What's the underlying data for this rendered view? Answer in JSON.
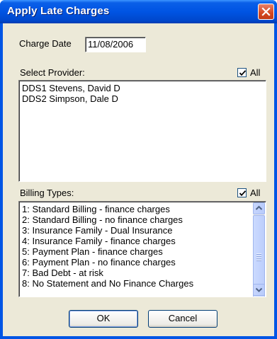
{
  "window": {
    "title": "Apply Late Charges"
  },
  "charge_date": {
    "label": "Charge Date",
    "value": "11/08/2006"
  },
  "provider": {
    "label": "Select Provider:",
    "all_label": "All",
    "all_checked": true,
    "items": [
      "DDS1 Stevens, David D",
      "DDS2 Simpson, Dale D"
    ]
  },
  "billing": {
    "label": "Billing Types:",
    "all_label": "All",
    "all_checked": true,
    "items": [
      "1: Standard Billing - finance charges",
      "2: Standard Billing - no finance charges",
      "3: Insurance Family - Dual Insurance",
      "4: Insurance Family - finance charges",
      "5: Payment Plan - finance charges",
      "6: Payment Plan - no finance charges",
      "7: Bad Debt - at risk",
      "8: No Statement and No Finance Charges"
    ]
  },
  "buttons": {
    "ok": "OK",
    "cancel": "Cancel"
  },
  "icons": {
    "close": "close-icon",
    "check": "check-icon",
    "scroll_up": "arrow-up-icon",
    "scroll_down": "arrow-down-icon"
  }
}
